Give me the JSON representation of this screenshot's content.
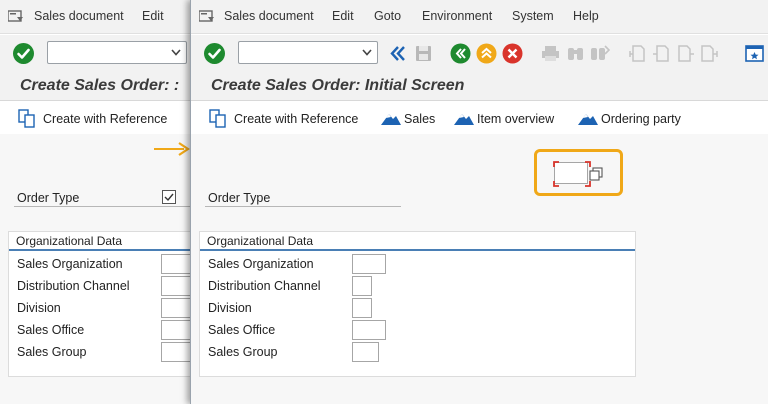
{
  "menu": {
    "sales_document": "Sales document",
    "edit": "Edit",
    "goto": "Goto",
    "environment": "Environment",
    "system": "System",
    "help": "Help"
  },
  "title": "Create Sales Order: Initial Screen",
  "title_back_truncated": "Create Sales Order: :",
  "app_toolbar": {
    "create_with_reference": "Create with Reference",
    "sales": "Sales",
    "item_overview": "Item overview",
    "ordering_party": "Ordering party"
  },
  "fields": {
    "order_type": "Order Type"
  },
  "org_data": {
    "title": "Organizational Data",
    "rows": [
      "Sales Organization",
      "Distribution Channel",
      "Division",
      "Sales Office",
      "Sales Group"
    ]
  },
  "icons": [
    "menu-icon",
    "ok-checkmark-icon",
    "dropdown-chevron-icon",
    "back-double-arrow-icon",
    "save-disk-icon",
    "back-icon",
    "exit-icon",
    "cancel-icon",
    "print-icon",
    "find-icon",
    "find-next-icon",
    "first-page-icon",
    "previous-page-icon",
    "next-page-icon",
    "last-page-icon",
    "window-icon",
    "create-with-reference-icon",
    "sales-mountain-icon",
    "item-overview-mountain-icon",
    "ordering-party-mountain-icon",
    "arrow-right-icon",
    "f4-help-icon"
  ],
  "colors": {
    "accent_orange": "#f0a818",
    "ok_green": "#1e8a2f",
    "cancel_red": "#d9342b",
    "exit_yellow": "#f0a818",
    "sap_blue": "#1d63b3",
    "group_rule_blue": "#4a7fb5"
  }
}
